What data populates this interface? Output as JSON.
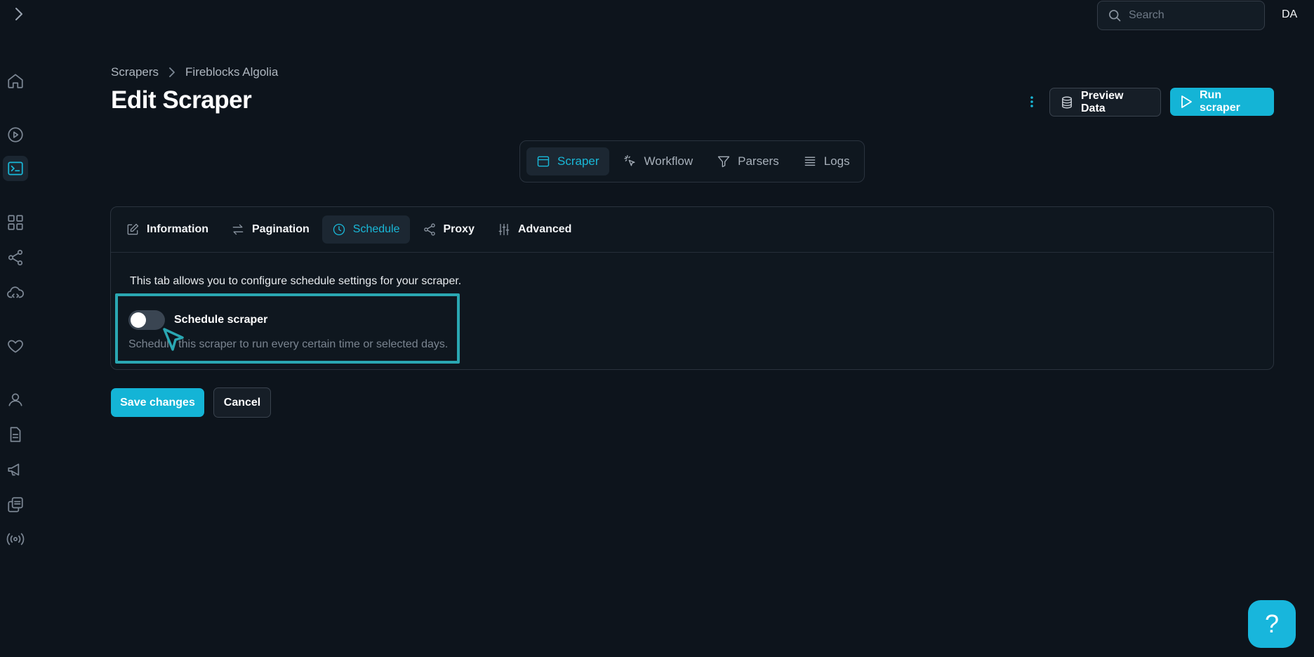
{
  "header": {
    "search": {
      "placeholder": "Search",
      "value": ""
    },
    "avatar_initials": "DA"
  },
  "breadcrumb": {
    "items": [
      "Scrapers",
      "Fireblocks Algolia"
    ]
  },
  "page": {
    "title": "Edit Scraper"
  },
  "actions": {
    "preview_label": "Preview Data",
    "run_label": "Run scraper"
  },
  "segments": [
    {
      "label": "Scraper",
      "icon": "browser-window-icon",
      "active": true
    },
    {
      "label": "Workflow",
      "icon": "pointer-click-icon",
      "active": false
    },
    {
      "label": "Parsers",
      "icon": "filter-funnel-icon",
      "active": false
    },
    {
      "label": "Logs",
      "icon": "list-lines-icon",
      "active": false
    }
  ],
  "tabs": [
    {
      "label": "Information",
      "icon": "pencil-edit-icon",
      "active": false
    },
    {
      "label": "Pagination",
      "icon": "arrows-swap-icon",
      "active": false
    },
    {
      "label": "Schedule",
      "icon": "clock-icon",
      "active": true
    },
    {
      "label": "Proxy",
      "icon": "share-nodes-icon",
      "active": false
    },
    {
      "label": "Advanced",
      "icon": "sliders-icon",
      "active": false
    }
  ],
  "schedule": {
    "description": "This tab allows you to configure schedule settings for your scraper.",
    "toggle_label": "Schedule scraper",
    "toggle_help": "Schedule this scraper to run every certain time or selected days.",
    "enabled": false
  },
  "form_actions": {
    "save_label": "Save changes",
    "cancel_label": "Cancel"
  },
  "help_button": {
    "glyph": "?"
  },
  "colors": {
    "accent": "#14b4d6",
    "background": "#0d141c",
    "highlight_box": "#2aa7b2"
  },
  "sidebar_icons": [
    "home-icon",
    "play-circle-icon",
    "terminal-icon",
    "grid-apps-icon",
    "share-nodes-icon",
    "cloud-code-icon",
    "heart-icon",
    "user-icon",
    "document-icon",
    "megaphone-icon",
    "copy-docs-icon",
    "broadcast-icon"
  ]
}
